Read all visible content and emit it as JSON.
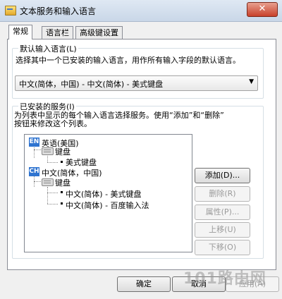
{
  "window": {
    "title": "文本服务和输入语言",
    "close_glyph": "✕"
  },
  "tabs": [
    {
      "label": "常规"
    },
    {
      "label": "语言栏"
    },
    {
      "label": "高级键设置"
    }
  ],
  "default_language": {
    "group_label": "默认输入语言(L)",
    "description": "选择其中一个已安装的输入语言，用作所有输入字段的默认语言。",
    "selected": "中文(简体，中国) - 中文(简体) - 美式键盘"
  },
  "installed_services": {
    "group_label": "已安装的服务(I)",
    "description_line1": "为列表中显示的每个输入语言选择服务。使用“添加”和“删除”",
    "description_line2": "按钮来修改这个列表。",
    "tree": {
      "lang1": {
        "badge": "EN",
        "label": "英语(美国)",
        "category": "键盘",
        "item": "美式键盘"
      },
      "lang2": {
        "badge": "CH",
        "label": "中文(简体，中国)",
        "category": "键盘",
        "item1": "中文(简体) - 美式键盘",
        "item2": "中文(简体) - 百度输入法"
      }
    }
  },
  "buttons": {
    "add": "添加(D)...",
    "remove": "删除(R)",
    "properties": "属性(P)...",
    "move_up": "上移(U)",
    "move_down": "下移(O)"
  },
  "footer": {
    "ok": "确定",
    "cancel": "取消",
    "apply": "应用(A)"
  },
  "watermark": "101路由网",
  "colors": {
    "lang_badge": "#2f74d0",
    "close_button": "#c8412b"
  }
}
